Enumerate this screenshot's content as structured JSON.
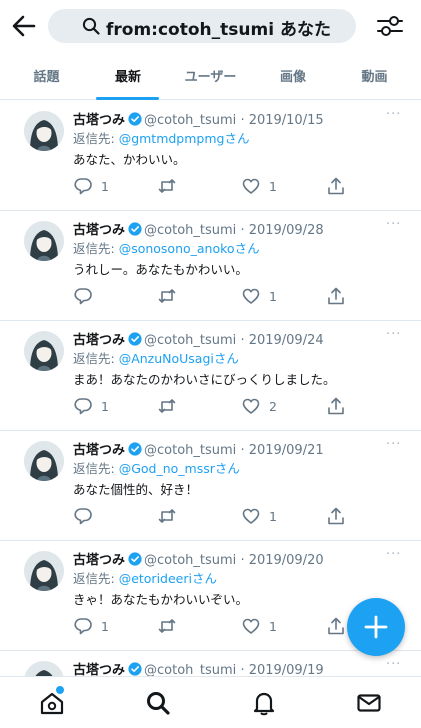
{
  "search": {
    "query": "from:cotoh_tsumi あなた"
  },
  "tabs": [
    "話題",
    "最新",
    "ユーザー",
    "画像",
    "動画"
  ],
  "active_tab": 1,
  "reply_prefix": "返信先: ",
  "reply_suffix": "さん",
  "more_glyph": "···",
  "tweets": [
    {
      "name": "古塔つみ",
      "handle": "@cotoh_tsumi",
      "date": "· 2019/10/15",
      "reply_to": "@gmtmdpmpmg",
      "text": "あなた、かわいい。",
      "replies": "1",
      "retweets": "",
      "likes": "1"
    },
    {
      "name": "古塔つみ",
      "handle": "@cotoh_tsumi",
      "date": "· 2019/09/28",
      "reply_to": "@sonosono_anoko",
      "text": "うれしー。あなたもかわいい。",
      "replies": "",
      "retweets": "",
      "likes": "1"
    },
    {
      "name": "古塔つみ",
      "handle": "@cotoh_tsumi",
      "date": "· 2019/09/24",
      "reply_to": "@AnzuNoUsagi",
      "text": "まあ！あなたのかわいさにびっくりしました。",
      "replies": "1",
      "retweets": "",
      "likes": "2"
    },
    {
      "name": "古塔つみ",
      "handle": "@cotoh_tsumi",
      "date": "· 2019/09/21",
      "reply_to": "@God_no_mssr",
      "text": "あなた個性的、好き！",
      "replies": "",
      "retweets": "",
      "likes": "1"
    },
    {
      "name": "古塔つみ",
      "handle": "@cotoh_tsumi",
      "date": "· 2019/09/20",
      "reply_to": "@etorideeri",
      "text": "きゃ！あなたもかわいいぞい。",
      "replies": "1",
      "retweets": "",
      "likes": "1"
    },
    {
      "name": "古塔つみ",
      "handle": "@cotoh_tsumi",
      "date": "· 2019/09/19",
      "reply_to": "",
      "text": "",
      "replies": "",
      "retweets": "",
      "likes": ""
    }
  ],
  "colors": {
    "accent": "#1da1f2",
    "text": "#14171a",
    "secondary": "#657786",
    "divider": "#e1e8ed"
  },
  "icons": {
    "back": "arrow-left-icon",
    "search": "search-icon",
    "filter": "sliders-icon",
    "verified": "verified-badge-icon",
    "reply": "reply-icon",
    "retweet": "retweet-icon",
    "like": "heart-icon",
    "share": "share-icon",
    "fab": "plus-icon",
    "nav": [
      "home-icon",
      "search-icon",
      "bell-icon",
      "mail-icon"
    ]
  }
}
